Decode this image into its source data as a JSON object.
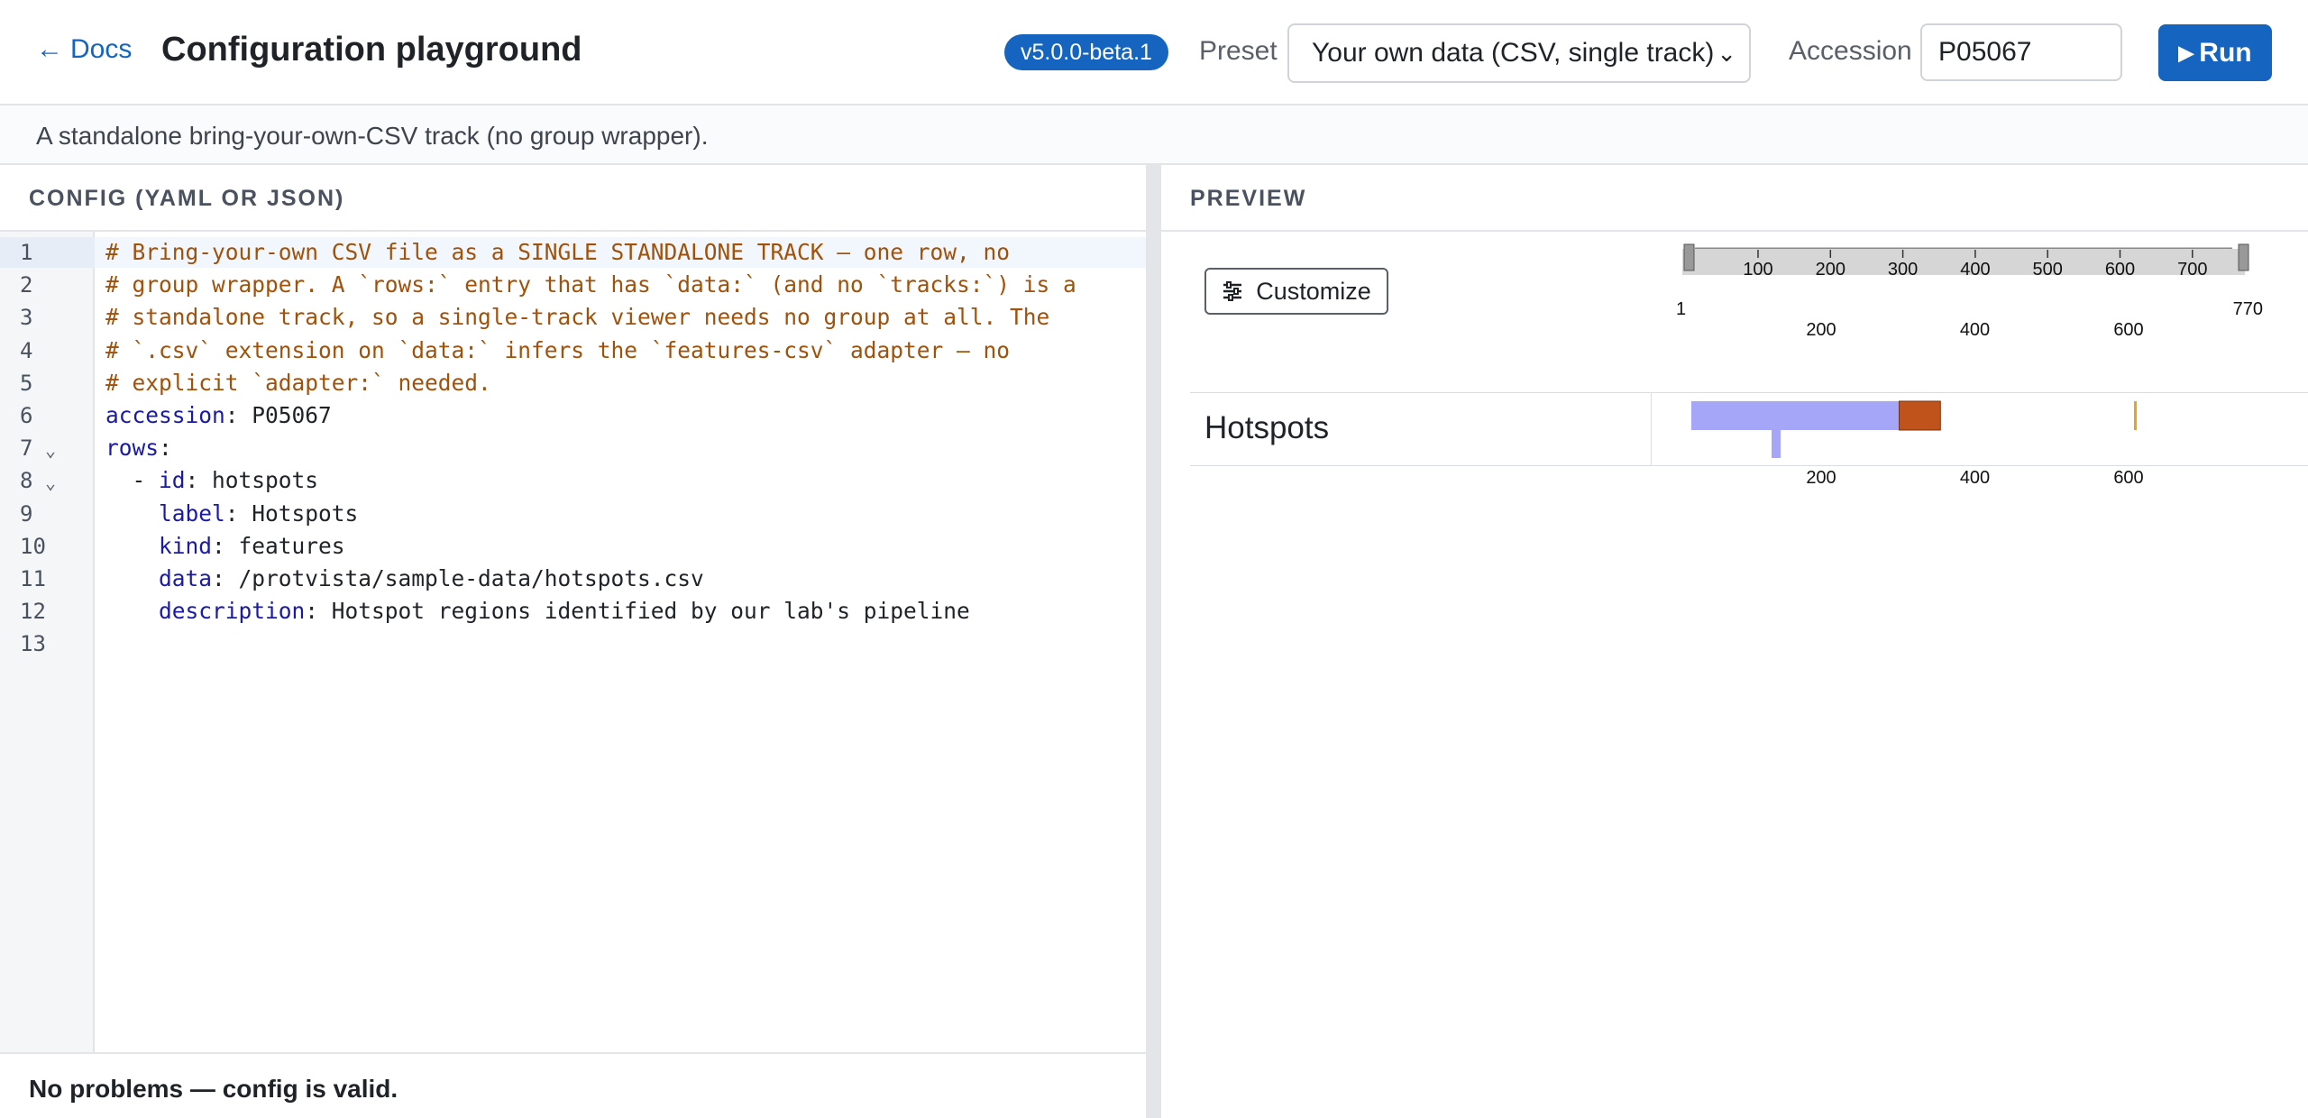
{
  "header": {
    "back_label": "Docs",
    "title": "Configuration playground",
    "version": "v5.0.0-beta.1",
    "preset_label": "Preset",
    "preset_value": "Your own data (CSV, single track)",
    "accession_label": "Accession",
    "accession_value": "P05067",
    "run_label": "Run"
  },
  "description": "A standalone bring-your-own-CSV track (no group wrapper).",
  "editor": {
    "heading": "CONFIG (YAML OR JSON)",
    "lines": [
      {
        "num": "1",
        "fold": false,
        "comment": "# Bring-your-own CSV file as a SINGLE STANDALONE TRACK — one row, no"
      },
      {
        "num": "2",
        "fold": false,
        "comment": "# group wrapper. A `rows:` entry that has `data:` (and no `tracks:`) is a"
      },
      {
        "num": "3",
        "fold": false,
        "comment": "# standalone track, so a single-track viewer needs no group at all. The"
      },
      {
        "num": "4",
        "fold": false,
        "comment": "# `.csv` extension on `data:` infers the `features-csv` adapter — no"
      },
      {
        "num": "5",
        "fold": false,
        "comment": "# explicit `adapter:` needed."
      },
      {
        "num": "6",
        "fold": false,
        "indent": "",
        "key": "accession",
        "value": " P05067"
      },
      {
        "num": "7",
        "fold": true,
        "indent": "",
        "key": "rows",
        "value": ""
      },
      {
        "num": "8",
        "fold": true,
        "indent": "  - ",
        "key": "id",
        "value": " hotspots"
      },
      {
        "num": "9",
        "fold": false,
        "indent": "    ",
        "key": "label",
        "value": " Hotspots"
      },
      {
        "num": "10",
        "fold": false,
        "indent": "    ",
        "key": "kind",
        "value": " features"
      },
      {
        "num": "11",
        "fold": false,
        "indent": "    ",
        "key": "data",
        "value": " /protvista/sample-data/hotspots.csv"
      },
      {
        "num": "12",
        "fold": false,
        "indent": "    ",
        "key": "description",
        "value": " Hotspot regions identified by our lab's pipeline"
      },
      {
        "num": "13",
        "fold": false,
        "indent": "",
        "key": "",
        "value": ""
      }
    ],
    "status": "No problems — config is valid."
  },
  "preview": {
    "heading": "PREVIEW",
    "customize_label": "Customize",
    "navigation": {
      "start": "1",
      "end": "770",
      "length": 770,
      "top_ticks": [
        "100",
        "200",
        "300",
        "400",
        "500",
        "600",
        "700"
      ],
      "bottom_ticks": [
        "200",
        "400",
        "600"
      ]
    },
    "track": {
      "label": "Hotspots",
      "axis_ticks": [
        "200",
        "400",
        "600"
      ],
      "features": [
        {
          "start": 1,
          "end": 290,
          "color": "#a6a6f8",
          "row": 0
        },
        {
          "start": 290,
          "end": 345,
          "color": "#c0521c",
          "row": 0
        },
        {
          "start": 603,
          "end": 605,
          "color": "#f0a020",
          "row": 0
        },
        {
          "start": 120,
          "end": 132,
          "color": "#a6a6f8",
          "row": 1
        }
      ]
    }
  },
  "colors": {
    "accent": "#1565c0",
    "comment": "#a0520a",
    "yaml_key": "#1a1aa6"
  }
}
